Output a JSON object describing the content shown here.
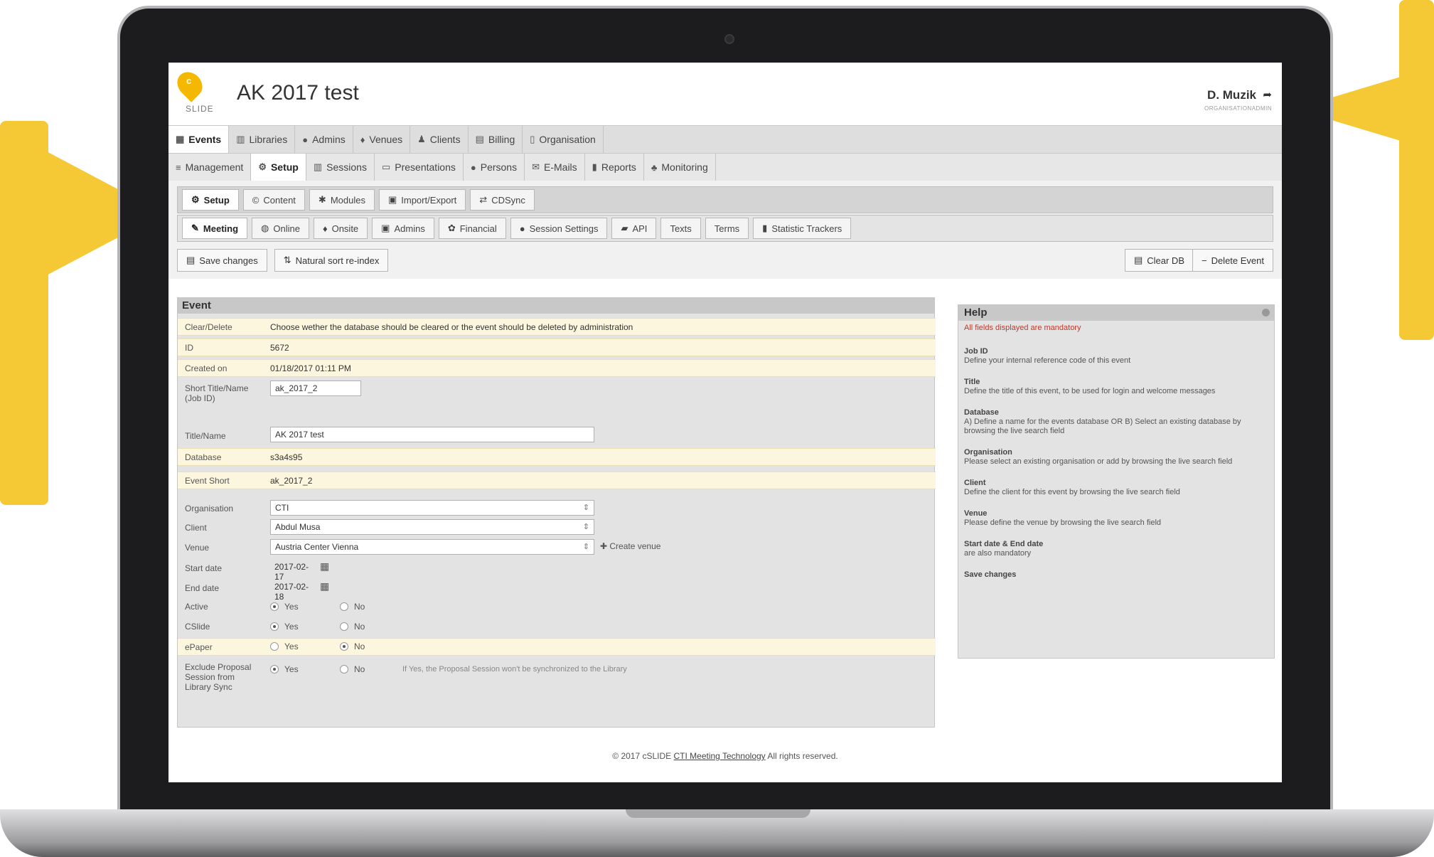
{
  "app": {
    "logo_text": "SLIDE",
    "event_title": "AK 2017 test",
    "user_name": "D. Muzik",
    "user_role": "ORGANISATIONADMIN"
  },
  "main_nav": [
    {
      "label": "Events",
      "icon": "calendar-icon",
      "active": true
    },
    {
      "label": "Libraries",
      "icon": "books-icon"
    },
    {
      "label": "Admins",
      "icon": "user-icon"
    },
    {
      "label": "Venues",
      "icon": "map-marker-icon"
    },
    {
      "label": "Clients",
      "icon": "person-icon"
    },
    {
      "label": "Billing",
      "icon": "billing-icon"
    },
    {
      "label": "Organisation",
      "icon": "building-icon"
    }
  ],
  "event_nav": [
    {
      "label": "Management",
      "icon": "list-icon"
    },
    {
      "label": "Setup",
      "icon": "gears-icon",
      "active": true
    },
    {
      "label": "Sessions",
      "icon": "table-icon"
    },
    {
      "label": "Presentations",
      "icon": "monitor-icon"
    },
    {
      "label": "Persons",
      "icon": "user-icon"
    },
    {
      "label": "E-Mails",
      "icon": "envelope-icon"
    },
    {
      "label": "Reports",
      "icon": "bar-chart-icon"
    },
    {
      "label": "Monitoring",
      "icon": "users-icon"
    }
  ],
  "setup_nav": [
    {
      "label": "Setup",
      "icon": "gears-icon",
      "active": true
    },
    {
      "label": "Content",
      "icon": "copyright-icon"
    },
    {
      "label": "Modules",
      "icon": "puzzle-icon"
    },
    {
      "label": "Import/Export",
      "icon": "archive-icon"
    },
    {
      "label": "CDSync",
      "icon": "exchange-icon"
    }
  ],
  "meeting_nav": [
    {
      "label": "Meeting",
      "icon": "wrench-icon",
      "active": true
    },
    {
      "label": "Online",
      "icon": "globe-icon"
    },
    {
      "label": "Onsite",
      "icon": "map-marker-icon"
    },
    {
      "label": "Admins",
      "icon": "lock-icon"
    },
    {
      "label": "Financial",
      "icon": "money-icon"
    },
    {
      "label": "Session Settings",
      "icon": "user-icon"
    },
    {
      "label": "API",
      "icon": "car-icon"
    },
    {
      "label": "Texts",
      "icon": ""
    },
    {
      "label": "Terms",
      "icon": ""
    },
    {
      "label": "Statistic Trackers",
      "icon": "bar-chart-icon"
    }
  ],
  "actions": {
    "save_changes": "Save changes",
    "natural_sort": "Natural sort re-index",
    "clear_db": "Clear DB",
    "delete_event": "Delete Event"
  },
  "event": {
    "panel_title": "Event",
    "rows": {
      "clear_delete": {
        "label": "Clear/Delete",
        "value": "Choose wether the database should be cleared or the event should be deleted by administration"
      },
      "id": {
        "label": "ID",
        "value": "5672"
      },
      "created_on": {
        "label": "Created on",
        "value": "01/18/2017 01:11 PM"
      },
      "short_title": {
        "label": "Short Title/Name (Job ID)",
        "value": "ak_2017_2"
      },
      "title_name": {
        "label": "Title/Name",
        "value": "AK 2017 test"
      },
      "database": {
        "label": "Database",
        "value": "s3a4s95"
      },
      "event_short": {
        "label": "Event Short",
        "value": "ak_2017_2"
      },
      "organisation": {
        "label": "Organisation",
        "value": "CTI"
      },
      "client": {
        "label": "Client",
        "value": "Abdul Musa"
      },
      "venue": {
        "label": "Venue",
        "value": "Austria Center Vienna"
      },
      "create_venue": "Create venue",
      "start_date": {
        "label": "Start date",
        "value": "2017-02-17"
      },
      "end_date": {
        "label": "End date",
        "value": "2017-02-18"
      },
      "active": {
        "label": "Active"
      },
      "cslide": {
        "label": "CSlide"
      },
      "epaper": {
        "label": "ePaper"
      },
      "exclude": {
        "label": "Exclude Proposal Session from Library Sync",
        "note": "If Yes, the Proposal Session won't be synchronized to the Library"
      },
      "yes": "Yes",
      "no": "No"
    }
  },
  "help": {
    "title": "Help",
    "required_note": "All fields displayed are mandatory",
    "items": [
      {
        "title": "Job ID",
        "text": "Define your internal reference code of this event"
      },
      {
        "title": "Title",
        "text": "Define the title of this event, to be used for login and welcome messages"
      },
      {
        "title": "Database",
        "text": "A) Define a name for the events database OR B) Select an existing database by browsing the live search field"
      },
      {
        "title": "Organisation",
        "text": "Please select an existing organisation or add by browsing the live search field"
      },
      {
        "title": "Client",
        "text": "Define the client for this event by browsing the live search field"
      },
      {
        "title": "Venue",
        "text": "Please define the venue by browsing the live search field"
      },
      {
        "title": "Start date & End date",
        "text": "are also mandatory"
      },
      {
        "title": "Save changes",
        "text": ""
      }
    ]
  },
  "footer": {
    "prefix": "© 2017 cSLIDE",
    "link": "CTI Meeting Technology",
    "suffix": "All rights reserved."
  },
  "colors": {
    "callout": "#f5c836",
    "logo": "#f5b800",
    "highlight_row": "#fbf6dd",
    "required_text": "#c0392b"
  }
}
